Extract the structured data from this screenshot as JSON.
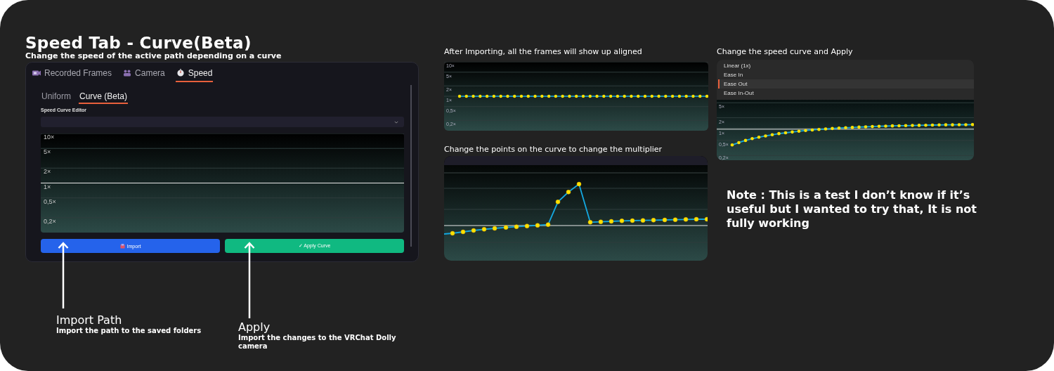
{
  "header": {
    "title": "Speed Tab - Curve(Beta)",
    "subtitle": "Change the speed of the active path depending on a curve"
  },
  "app_panel": {
    "tabs": [
      {
        "label": "Recorded Frames",
        "selected": false
      },
      {
        "label": "Camera",
        "selected": false
      },
      {
        "label": "Speed",
        "selected": true
      }
    ],
    "subtabs": [
      {
        "label": "Uniform",
        "selected": false
      },
      {
        "label": "Curve (Beta)",
        "selected": true
      }
    ],
    "editor_label": "Speed Curve Editor",
    "scale_labels": [
      "10×",
      "5×",
      "2×",
      "1×",
      "0,5×",
      "0,2×"
    ],
    "buttons": [
      {
        "label": "Import",
        "kind": "import"
      },
      {
        "label": "✓ Apply Curve",
        "kind": "apply"
      }
    ]
  },
  "callouts": [
    {
      "title": "Import Path",
      "text": "Import the path to the saved folders"
    },
    {
      "title": "Apply",
      "text": "Import the changes to the VRChat Dolly camera"
    }
  ],
  "steps": [
    {
      "kind": "aligned",
      "caption": "After Importing, all the frames will show up aligned",
      "scale_labels": [
        "10×",
        "5×",
        "2×",
        "1×",
        "0,5×",
        "0,2×"
      ]
    },
    {
      "kind": "edit",
      "caption": "Change the points on the curve to change the multiplier"
    },
    {
      "kind": "preset",
      "caption": "Change the speed curve and Apply",
      "menu": [
        {
          "label": "Linear (1x)",
          "selected": false
        },
        {
          "label": "Ease In",
          "selected": false
        },
        {
          "label": "Ease Out",
          "selected": true
        },
        {
          "label": "Ease In-Out",
          "selected": false
        }
      ],
      "scale_labels": [
        "5×",
        "2×",
        "1×",
        "0,5×",
        "0,2×"
      ]
    }
  ],
  "note": "Note : This is a test I don’t know if it’s useful but I wanted to try that, It is not fully working"
}
